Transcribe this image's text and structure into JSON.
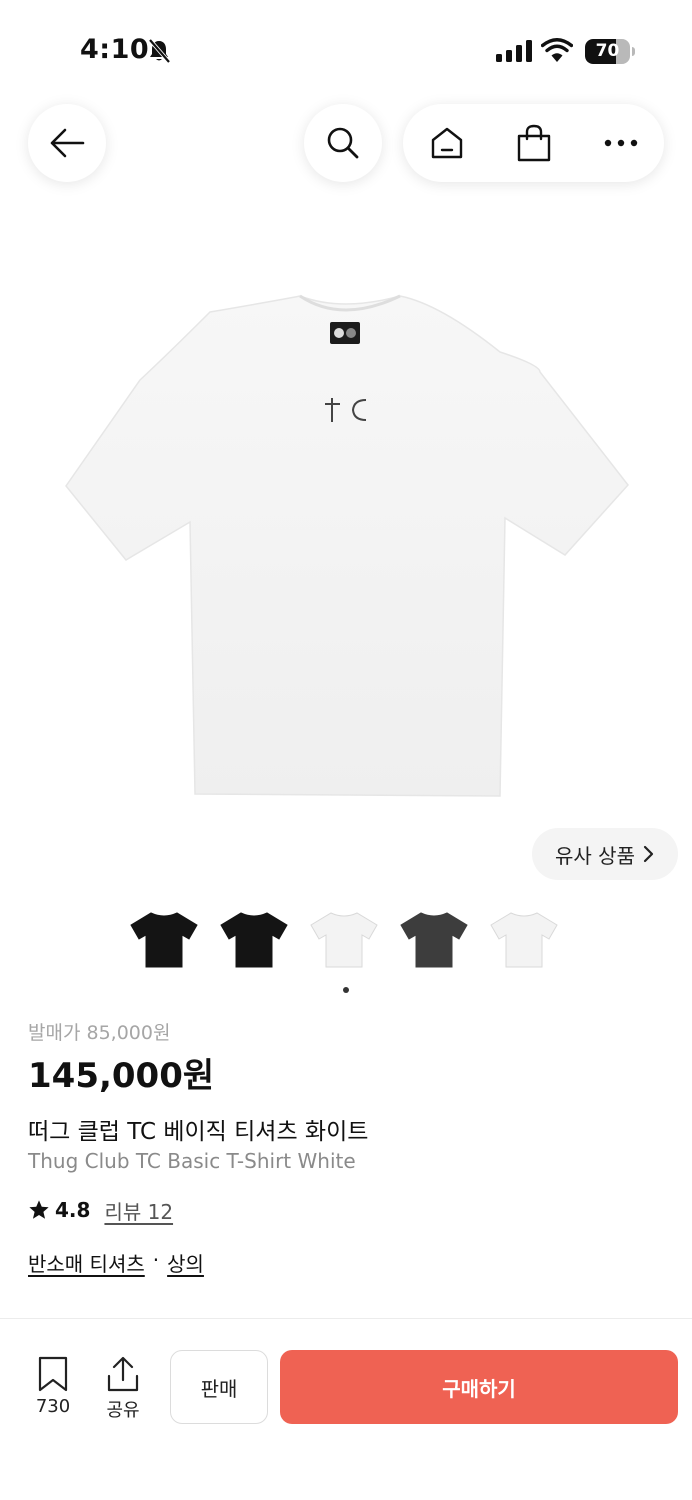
{
  "status": {
    "time": "4:10",
    "battery": "70",
    "battery_level": 0.7
  },
  "nav": {
    "back_icon": "arrow-left-icon",
    "search_icon": "search-icon",
    "home_icon": "home-icon",
    "shop_icon": "shopping-bag-icon",
    "more_icon": "more-dots-icon"
  },
  "similar": {
    "label": "유사 상품"
  },
  "thumbnails": [
    "black",
    "black",
    "white",
    "charcoal",
    "white"
  ],
  "product": {
    "release_price": "발매가 85,000원",
    "price": "145,000원",
    "name_ko": "떠그 클럽 TC 베이직 티셔츠 화이트",
    "name_en": "Thug Club TC Basic T-Shirt White",
    "rating": "4.8",
    "review_label": "리뷰 12",
    "category_1": "반소매 티셔츠",
    "category_sep": "·",
    "category_2": "상의"
  },
  "bottom": {
    "bookmark_count": "730",
    "share_label": "공유",
    "sell_label": "판매",
    "buy_label": "구매하기"
  },
  "colors": {
    "buy": "#ef6253",
    "chip": "#f4f4f4"
  }
}
